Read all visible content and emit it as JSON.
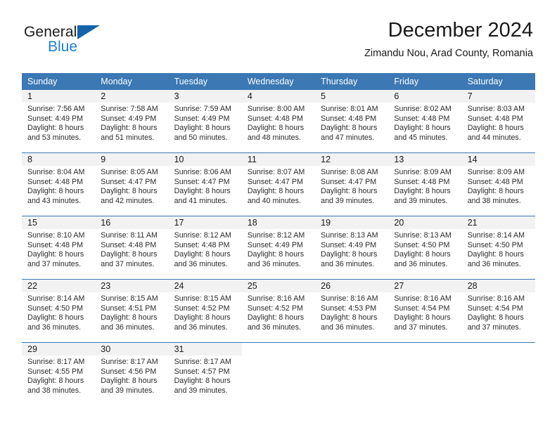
{
  "brand": {
    "word_one": "General",
    "word_two": "Blue",
    "triangle_icon": "triangle-icon",
    "accent_dark": "#1464aa",
    "accent_light": "#1b7fd4"
  },
  "header": {
    "title": "December 2024",
    "subtitle": "Zimandu Nou, Arad County, Romania"
  },
  "theme": {
    "header_bg": "#3b78b4",
    "daynum_bg": "#f2f2f2",
    "cell_bg": "#ffffff",
    "text": "#1a1a1a"
  },
  "weekdays": [
    "Sunday",
    "Monday",
    "Tuesday",
    "Wednesday",
    "Thursday",
    "Friday",
    "Saturday"
  ],
  "weeks": [
    {
      "days": [
        {
          "num": "1",
          "l1": "Sunrise: 7:56 AM",
          "l2": "Sunset: 4:49 PM",
          "l3": "Daylight: 8 hours",
          "l4": "and 53 minutes."
        },
        {
          "num": "2",
          "l1": "Sunrise: 7:58 AM",
          "l2": "Sunset: 4:49 PM",
          "l3": "Daylight: 8 hours",
          "l4": "and 51 minutes."
        },
        {
          "num": "3",
          "l1": "Sunrise: 7:59 AM",
          "l2": "Sunset: 4:49 PM",
          "l3": "Daylight: 8 hours",
          "l4": "and 50 minutes."
        },
        {
          "num": "4",
          "l1": "Sunrise: 8:00 AM",
          "l2": "Sunset: 4:48 PM",
          "l3": "Daylight: 8 hours",
          "l4": "and 48 minutes."
        },
        {
          "num": "5",
          "l1": "Sunrise: 8:01 AM",
          "l2": "Sunset: 4:48 PM",
          "l3": "Daylight: 8 hours",
          "l4": "and 47 minutes."
        },
        {
          "num": "6",
          "l1": "Sunrise: 8:02 AM",
          "l2": "Sunset: 4:48 PM",
          "l3": "Daylight: 8 hours",
          "l4": "and 45 minutes."
        },
        {
          "num": "7",
          "l1": "Sunrise: 8:03 AM",
          "l2": "Sunset: 4:48 PM",
          "l3": "Daylight: 8 hours",
          "l4": "and 44 minutes."
        }
      ]
    },
    {
      "days": [
        {
          "num": "8",
          "l1": "Sunrise: 8:04 AM",
          "l2": "Sunset: 4:48 PM",
          "l3": "Daylight: 8 hours",
          "l4": "and 43 minutes."
        },
        {
          "num": "9",
          "l1": "Sunrise: 8:05 AM",
          "l2": "Sunset: 4:47 PM",
          "l3": "Daylight: 8 hours",
          "l4": "and 42 minutes."
        },
        {
          "num": "10",
          "l1": "Sunrise: 8:06 AM",
          "l2": "Sunset: 4:47 PM",
          "l3": "Daylight: 8 hours",
          "l4": "and 41 minutes."
        },
        {
          "num": "11",
          "l1": "Sunrise: 8:07 AM",
          "l2": "Sunset: 4:47 PM",
          "l3": "Daylight: 8 hours",
          "l4": "and 40 minutes."
        },
        {
          "num": "12",
          "l1": "Sunrise: 8:08 AM",
          "l2": "Sunset: 4:47 PM",
          "l3": "Daylight: 8 hours",
          "l4": "and 39 minutes."
        },
        {
          "num": "13",
          "l1": "Sunrise: 8:09 AM",
          "l2": "Sunset: 4:48 PM",
          "l3": "Daylight: 8 hours",
          "l4": "and 39 minutes."
        },
        {
          "num": "14",
          "l1": "Sunrise: 8:09 AM",
          "l2": "Sunset: 4:48 PM",
          "l3": "Daylight: 8 hours",
          "l4": "and 38 minutes."
        }
      ]
    },
    {
      "days": [
        {
          "num": "15",
          "l1": "Sunrise: 8:10 AM",
          "l2": "Sunset: 4:48 PM",
          "l3": "Daylight: 8 hours",
          "l4": "and 37 minutes."
        },
        {
          "num": "16",
          "l1": "Sunrise: 8:11 AM",
          "l2": "Sunset: 4:48 PM",
          "l3": "Daylight: 8 hours",
          "l4": "and 37 minutes."
        },
        {
          "num": "17",
          "l1": "Sunrise: 8:12 AM",
          "l2": "Sunset: 4:48 PM",
          "l3": "Daylight: 8 hours",
          "l4": "and 36 minutes."
        },
        {
          "num": "18",
          "l1": "Sunrise: 8:12 AM",
          "l2": "Sunset: 4:49 PM",
          "l3": "Daylight: 8 hours",
          "l4": "and 36 minutes."
        },
        {
          "num": "19",
          "l1": "Sunrise: 8:13 AM",
          "l2": "Sunset: 4:49 PM",
          "l3": "Daylight: 8 hours",
          "l4": "and 36 minutes."
        },
        {
          "num": "20",
          "l1": "Sunrise: 8:13 AM",
          "l2": "Sunset: 4:50 PM",
          "l3": "Daylight: 8 hours",
          "l4": "and 36 minutes."
        },
        {
          "num": "21",
          "l1": "Sunrise: 8:14 AM",
          "l2": "Sunset: 4:50 PM",
          "l3": "Daylight: 8 hours",
          "l4": "and 36 minutes."
        }
      ]
    },
    {
      "days": [
        {
          "num": "22",
          "l1": "Sunrise: 8:14 AM",
          "l2": "Sunset: 4:50 PM",
          "l3": "Daylight: 8 hours",
          "l4": "and 36 minutes."
        },
        {
          "num": "23",
          "l1": "Sunrise: 8:15 AM",
          "l2": "Sunset: 4:51 PM",
          "l3": "Daylight: 8 hours",
          "l4": "and 36 minutes."
        },
        {
          "num": "24",
          "l1": "Sunrise: 8:15 AM",
          "l2": "Sunset: 4:52 PM",
          "l3": "Daylight: 8 hours",
          "l4": "and 36 minutes."
        },
        {
          "num": "25",
          "l1": "Sunrise: 8:16 AM",
          "l2": "Sunset: 4:52 PM",
          "l3": "Daylight: 8 hours",
          "l4": "and 36 minutes."
        },
        {
          "num": "26",
          "l1": "Sunrise: 8:16 AM",
          "l2": "Sunset: 4:53 PM",
          "l3": "Daylight: 8 hours",
          "l4": "and 36 minutes."
        },
        {
          "num": "27",
          "l1": "Sunrise: 8:16 AM",
          "l2": "Sunset: 4:54 PM",
          "l3": "Daylight: 8 hours",
          "l4": "and 37 minutes."
        },
        {
          "num": "28",
          "l1": "Sunrise: 8:16 AM",
          "l2": "Sunset: 4:54 PM",
          "l3": "Daylight: 8 hours",
          "l4": "and 37 minutes."
        }
      ]
    },
    {
      "days": [
        {
          "num": "29",
          "l1": "Sunrise: 8:17 AM",
          "l2": "Sunset: 4:55 PM",
          "l3": "Daylight: 8 hours",
          "l4": "and 38 minutes."
        },
        {
          "num": "30",
          "l1": "Sunrise: 8:17 AM",
          "l2": "Sunset: 4:56 PM",
          "l3": "Daylight: 8 hours",
          "l4": "and 39 minutes."
        },
        {
          "num": "31",
          "l1": "Sunrise: 8:17 AM",
          "l2": "Sunset: 4:57 PM",
          "l3": "Daylight: 8 hours",
          "l4": "and 39 minutes."
        },
        {
          "num": "",
          "l1": "",
          "l2": "",
          "l3": "",
          "l4": ""
        },
        {
          "num": "",
          "l1": "",
          "l2": "",
          "l3": "",
          "l4": ""
        },
        {
          "num": "",
          "l1": "",
          "l2": "",
          "l3": "",
          "l4": ""
        },
        {
          "num": "",
          "l1": "",
          "l2": "",
          "l3": "",
          "l4": ""
        }
      ]
    }
  ]
}
